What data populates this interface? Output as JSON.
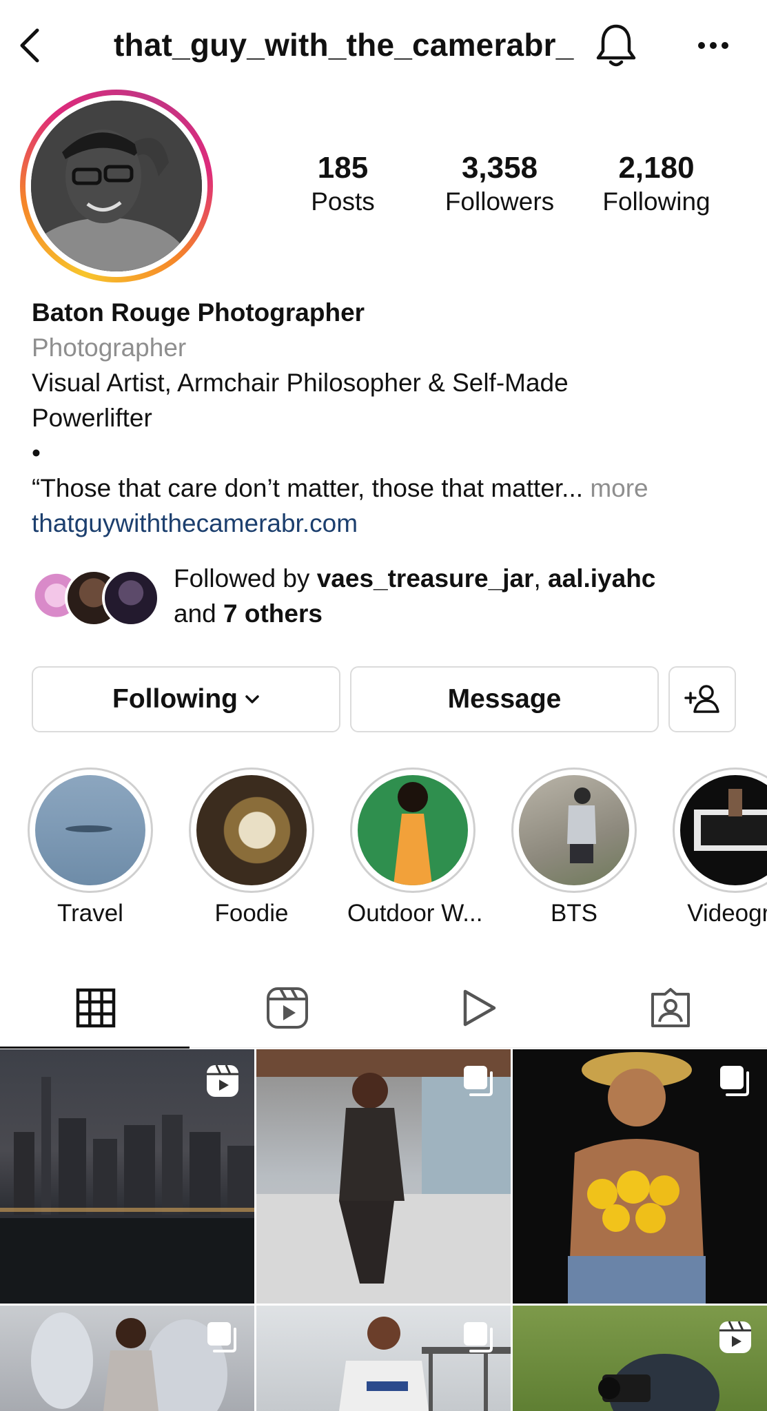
{
  "header": {
    "username": "that_guy_with_the_camerabr_"
  },
  "stats": {
    "posts": {
      "value": "185",
      "label": "Posts"
    },
    "followers": {
      "value": "3,358",
      "label": "Followers"
    },
    "following": {
      "value": "2,180",
      "label": "Following"
    }
  },
  "bio": {
    "name": "Baton Rouge Photographer",
    "category": "Photographer",
    "line1": "Visual Artist, Armchair Philosopher & Self-Made",
    "line2": "Powerlifter",
    "bullet": "•",
    "quote": "“Those that care don’t matter, those that matter...",
    "more": "more",
    "link": "thatguywiththecamerabr.com"
  },
  "followed_by": {
    "prefix": "Followed by ",
    "user1": "vaes_treasure_jar",
    "sep": ", ",
    "user2": "aal.iyahc",
    "and": "and ",
    "others": "7 others"
  },
  "buttons": {
    "following": "Following",
    "message": "Message"
  },
  "highlights": [
    {
      "label": "Travel"
    },
    {
      "label": "Foodie"
    },
    {
      "label": "Outdoor W..."
    },
    {
      "label": "BTS"
    },
    {
      "label": "Videogra"
    }
  ],
  "tabs": {
    "grid": "grid-icon",
    "reels": "reels-icon",
    "videos": "play-icon",
    "tagged": "tagged-icon"
  },
  "colors": {
    "link": "#1c3f6e",
    "muted": "#8e8e8e",
    "border": "#dbdbdb"
  }
}
